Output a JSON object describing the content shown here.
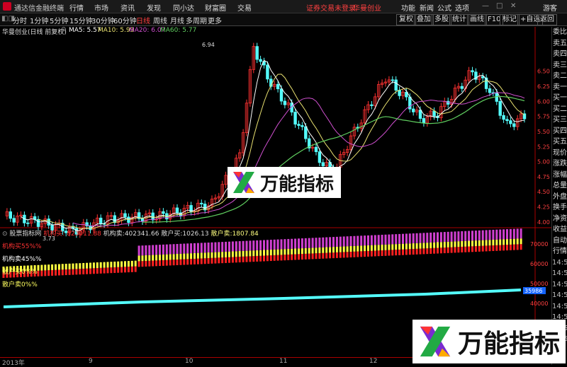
{
  "app": {
    "title": "通达信金融终端",
    "status_red": "证券交易未登录",
    "stock_red": "华曼创业",
    "menu": [
      "行情",
      "市场",
      "资讯",
      "发现",
      "同小达",
      "财富圈",
      "交易"
    ],
    "right_menu": [
      "功能",
      "新闻",
      "公式",
      "选项"
    ],
    "guest": "游客",
    "win_buttons": [
      "—",
      "□",
      "✕"
    ]
  },
  "toolbar": {
    "periods": [
      "分时",
      "1分钟",
      "5分钟",
      "15分钟",
      "30分钟",
      "60分钟",
      "日线",
      "周线",
      "月线",
      "多周期",
      "更多"
    ],
    "right": [
      "复权",
      "叠加",
      "多股",
      "统计",
      "画线",
      "F10",
      "标记",
      "+自选",
      "返回"
    ]
  },
  "info": {
    "name": "华曼创业(日线 前复权)",
    "ma5": "MA5: 5.57",
    "ma10": "MA10: 5.99",
    "ma20": "MA20: 6.07",
    "ma60": "MA60: 5.77",
    "high_label": "6.94",
    "low_label": "3.73"
  },
  "price_axis": [
    "6.50",
    "6.25",
    "6.00",
    "5.75",
    "5.50",
    "5.25",
    "5.00",
    "4.75",
    "4.50",
    "4.25",
    "4.00"
  ],
  "indicator": {
    "name": "股票指标网",
    "v1": "823011.88",
    "v1_label": "机构买:",
    "v2_label": "机构卖:",
    "v2": "402341.66",
    "v3_label": "散户买:",
    "v3": "1026.13",
    "v4_label": "散户卖:",
    "v4": "1807.84",
    "l1": "机构买55%%",
    "l2": "机构卖45%%",
    "l3": "散户买0%%",
    "l4": "散户卖0%%",
    "box": "35986"
  },
  "ind_axis": [
    "70000",
    "60000",
    "50000",
    "40000",
    "30000"
  ],
  "side_items": [
    "委比",
    "卖五",
    "卖四",
    "卖三",
    "卖二",
    "卖一",
    "买一",
    "买二",
    "买三",
    "买四",
    "买五",
    "现价",
    "涨跌",
    "涨幅",
    "总量",
    "外盘",
    "换手",
    "净资",
    "收益",
    "自动",
    "行情",
    "14:5",
    "14:5",
    "14:5",
    "14:5",
    "14:5",
    "14:5",
    "14:5",
    "14:5"
  ],
  "xaxis": {
    "year": "2013年",
    "months": [
      "9",
      "10",
      "11",
      "12"
    ]
  },
  "watermark": "万能指标",
  "colors": {
    "up": "#ff3232",
    "down": "#54ffff",
    "ma5": "#ffffff",
    "ma10": "#e8e070",
    "ma20": "#d050d0",
    "ma60": "#60d060"
  }
}
